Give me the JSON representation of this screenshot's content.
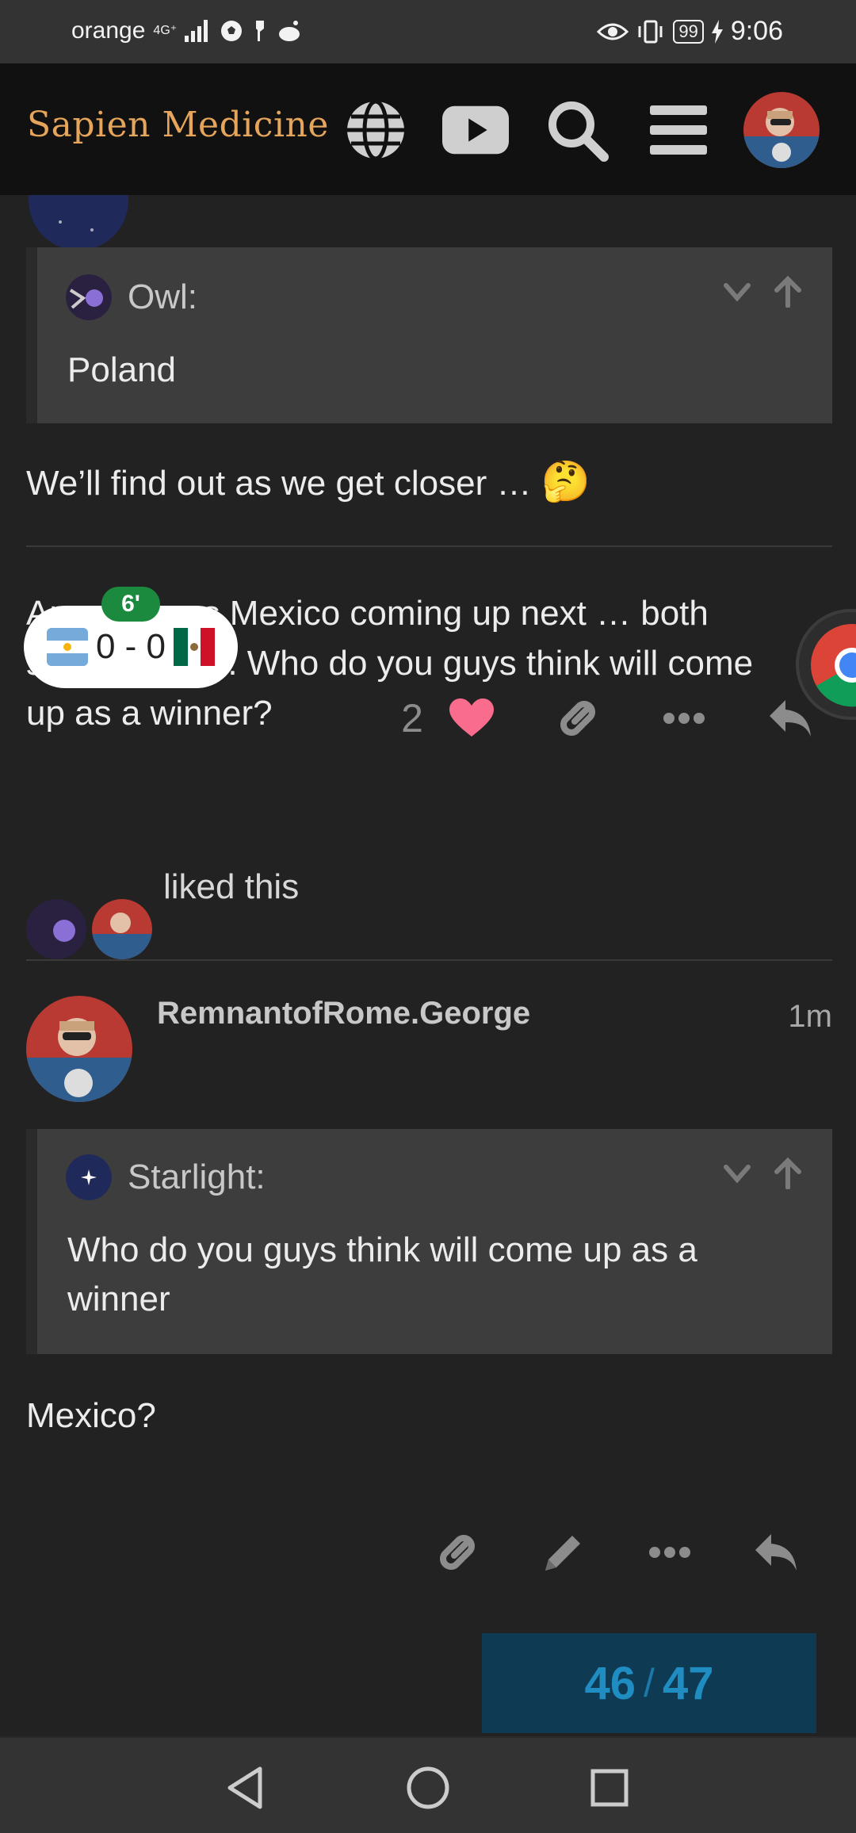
{
  "status_bar": {
    "carrier": "orange",
    "network": "4G⁺",
    "battery": "99",
    "time": "9:06"
  },
  "header": {
    "brand": "Sapien Medicine",
    "icons": [
      "globe-icon",
      "youtube-icon",
      "search-icon",
      "menu-icon",
      "user-avatar"
    ]
  },
  "post1": {
    "quote": {
      "author": "Owl:",
      "text": "Poland"
    },
    "text": "We’ll find out as we get closer …",
    "emoji": "🤔"
  },
  "post2": {
    "text": "Argentina vs Mexico coming up next … both strong teams. Who do you guys think will come up as a winner?",
    "like_count": "2",
    "liked_this": "liked this"
  },
  "score_widget": {
    "minute": "6'",
    "score": "0 - 0",
    "home_flag": "argentina-flag-icon",
    "away_flag": "mexico-flag-icon"
  },
  "post3": {
    "author": "RemnantofRome.George",
    "time": "1m",
    "quote": {
      "author": "Starlight:",
      "text": "Who do you guys think will come up as a winner"
    },
    "text": "Mexico?"
  },
  "progress": {
    "current": "46",
    "separator": "/",
    "total": "47"
  },
  "colors": {
    "brand": "#e6a55b",
    "background": "#222222",
    "quote_bg": "#3d3d3d",
    "like": "#fa6c8d",
    "progress_text": "#1f8cc2"
  }
}
